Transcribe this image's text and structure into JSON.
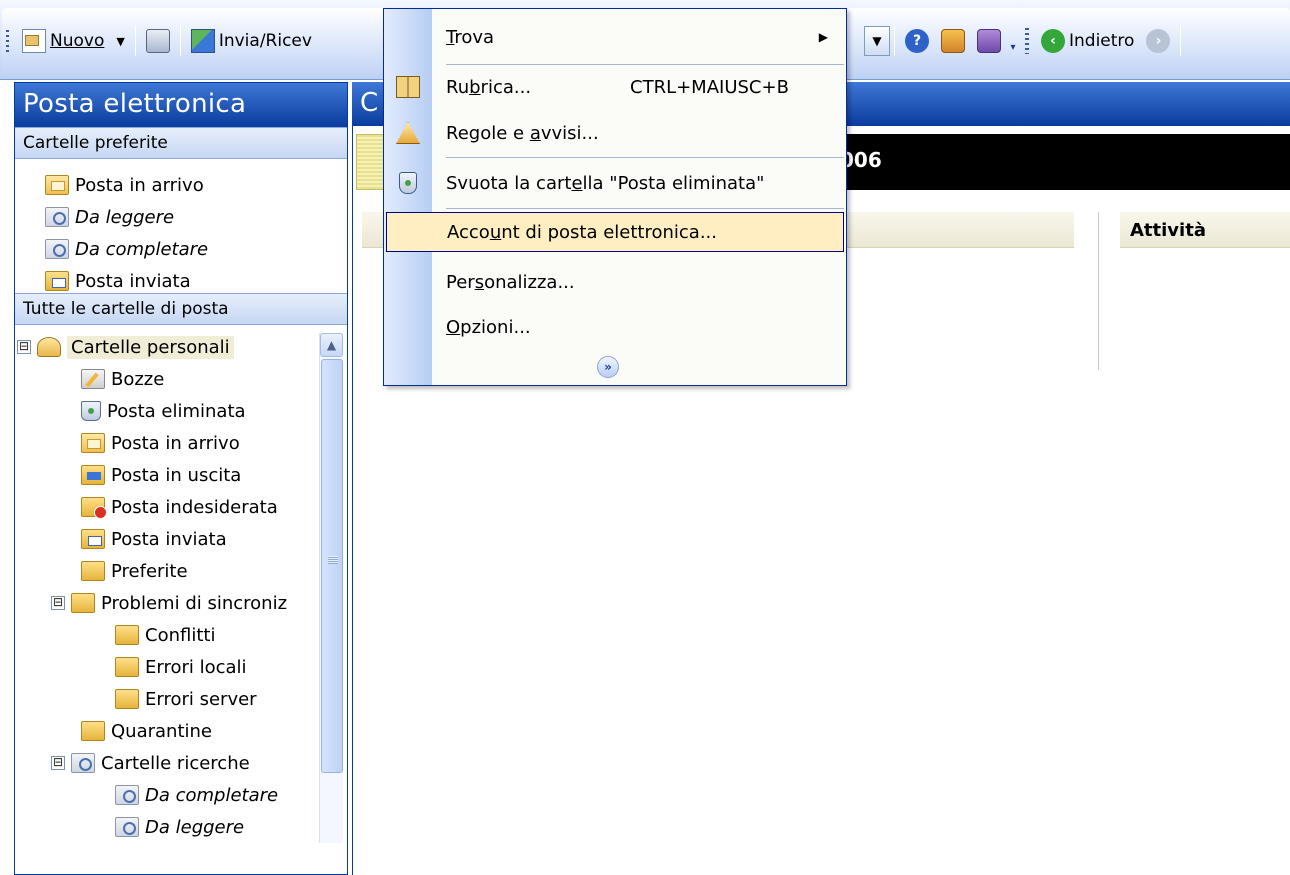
{
  "toolbar": {
    "new_label": "Nuovo",
    "send_receive_label": "Invia/Ricev",
    "back_label": "Indietro"
  },
  "nav": {
    "header": "Posta elettronica",
    "favorites_title": "Cartelle preferite",
    "favorites": [
      {
        "label": "Posta in arrivo",
        "icon": "inbox-icon"
      },
      {
        "label": "Da leggere",
        "icon": "search-folder-icon"
      },
      {
        "label": "Da completare",
        "icon": "search-folder-icon"
      },
      {
        "label": "Posta inviata",
        "icon": "sent-items-icon"
      }
    ],
    "all_title": "Tutte le cartelle di posta",
    "tree": [
      {
        "label": "Cartelle personali",
        "expander": "⊟"
      },
      {
        "label": "Bozze"
      },
      {
        "label": "Posta eliminata"
      },
      {
        "label": "Posta in arrivo"
      },
      {
        "label": "Posta in uscita"
      },
      {
        "label": "Posta indesiderata"
      },
      {
        "label": "Posta inviata"
      },
      {
        "label": "Preferite"
      },
      {
        "label": "Problemi di sincroniz",
        "expander": "⊟"
      },
      {
        "label": "Conflitti"
      },
      {
        "label": "Errori locali"
      },
      {
        "label": "Errori server"
      },
      {
        "label": "Quarantine"
      },
      {
        "label": "Cartelle ricerche",
        "expander": "⊟"
      },
      {
        "label": "Da completare"
      },
      {
        "label": "Da leggere"
      }
    ]
  },
  "main": {
    "header_letter": "C",
    "date_fragment": "006",
    "tasks_header": "Attività"
  },
  "menu": {
    "items": [
      {
        "pre": "",
        "ul": "T",
        "post": "rova",
        "shortcut": "",
        "submenu": true
      },
      {
        "pre": "Ru",
        "ul": "b",
        "post": "rica...",
        "shortcut": "CTRL+MAIUSC+B"
      },
      {
        "pre": "Regole e ",
        "ul": "a",
        "post": "vvisi..."
      },
      {
        "pre": "Svuota la cart",
        "ul": "e",
        "post": "lla \"Posta eliminata\""
      },
      {
        "pre": "Acco",
        "ul": "u",
        "post": "nt di posta elettronica..."
      },
      {
        "pre": "Per",
        "ul": "s",
        "post": "onalizza..."
      },
      {
        "pre": "",
        "ul": "O",
        "post": "pzioni..."
      }
    ],
    "expand_glyph": "»",
    "highlight_color": "#ffeec2"
  },
  "colors": {
    "header_blue": "#0a3c9d",
    "section_bar": "#c6d7f3"
  }
}
